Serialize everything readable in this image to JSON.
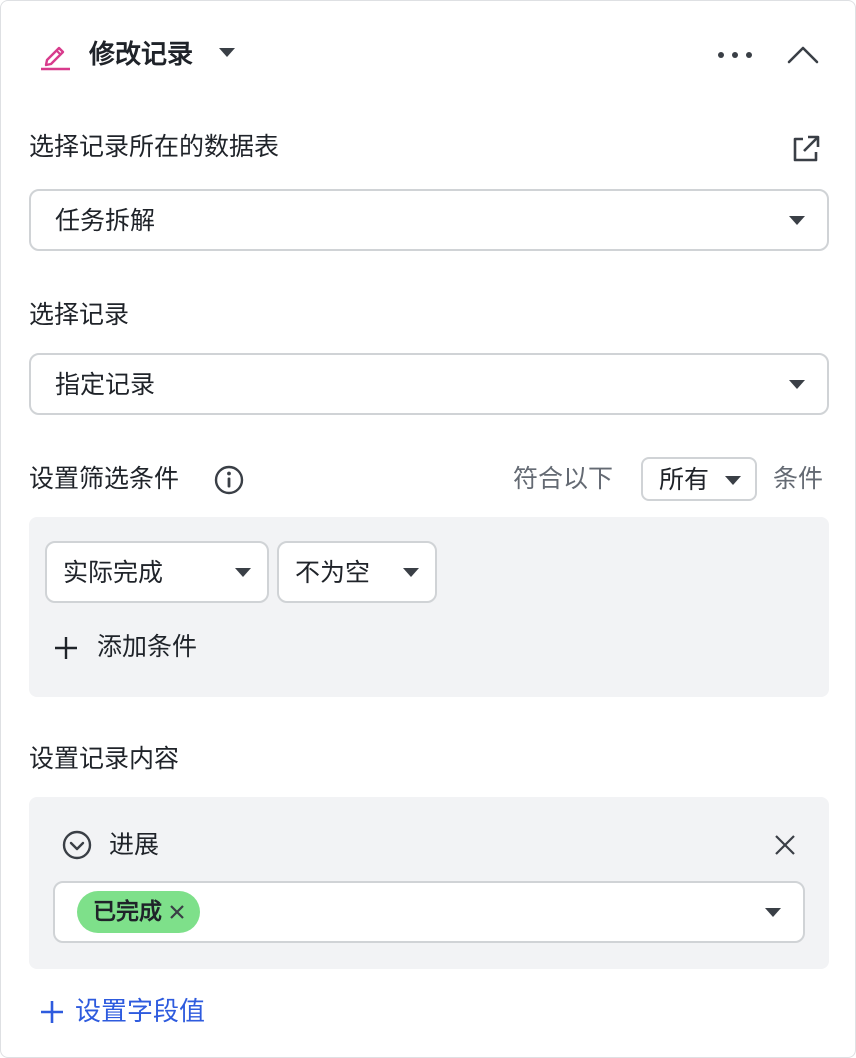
{
  "header": {
    "title": "修改记录",
    "icon": "pencil-icon",
    "accent_color": "#d83b8c"
  },
  "table_section": {
    "label": "选择记录所在的数据表",
    "selected": "任务拆解"
  },
  "record_section": {
    "label": "选择记录",
    "selected": "指定记录"
  },
  "filter_section": {
    "label": "设置筛选条件",
    "match_prefix": "符合以下",
    "match_mode": "所有",
    "match_suffix": "条件",
    "condition": {
      "field": "实际完成",
      "operator": "不为空"
    },
    "add_condition": "添加条件"
  },
  "content_section": {
    "label": "设置记录内容",
    "field_name": "进展",
    "tag": "已完成",
    "tag_color": "#7ee08a",
    "add_field": "设置字段值",
    "link_color": "#2e5bde"
  }
}
